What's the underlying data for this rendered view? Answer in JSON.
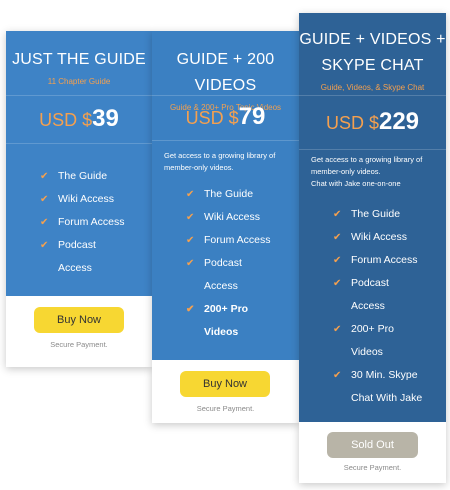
{
  "colors": {
    "blue1": "#3e83c6",
    "blue2": "#3b80c2",
    "blue3": "#2e6296",
    "accent": "#f4a04f",
    "button_yellow": "#f7d732",
    "button_gray": "#b8b4a7"
  },
  "plans": [
    {
      "title": "JUST THE GUIDE",
      "subtitle": "11 Chapter Guide",
      "currency": "USD $",
      "price": "39",
      "description": [],
      "features": [
        "The Guide",
        "Wiki Access",
        "Forum Access",
        "Podcast",
        "Access"
      ],
      "button": "Buy Now",
      "secure": "Secure Payment."
    },
    {
      "title": "GUIDE + 200 VIDEOS",
      "subtitle": "Guide & 200+ Pro Topic Videos",
      "currency": "USD $",
      "price": "79",
      "description": [
        "Get access to a growing library of",
        "member-only videos."
      ],
      "features": [
        "The Guide",
        "Wiki Access",
        "Forum Access",
        "Podcast",
        "Access",
        "200+ Pro",
        "Videos"
      ],
      "button": "Buy Now",
      "secure": "Secure Payment."
    },
    {
      "title_line1": "GUIDE + VIDEOS +",
      "title_line2": "SKYPE CHAT",
      "subtitle": "Guide, Videos, & Skype Chat",
      "currency": "USD $",
      "price": "229",
      "description": [
        "Get access to a growing library of",
        "member-only videos.",
        "Chat with Jake one-on-one"
      ],
      "features": [
        "The Guide",
        "Wiki Access",
        "Forum Access",
        "Podcast",
        "Access",
        "200+ Pro",
        "Videos",
        "30 Min. Skype",
        "Chat With Jake"
      ],
      "button": "Sold Out",
      "secure": "Secure Payment."
    }
  ]
}
